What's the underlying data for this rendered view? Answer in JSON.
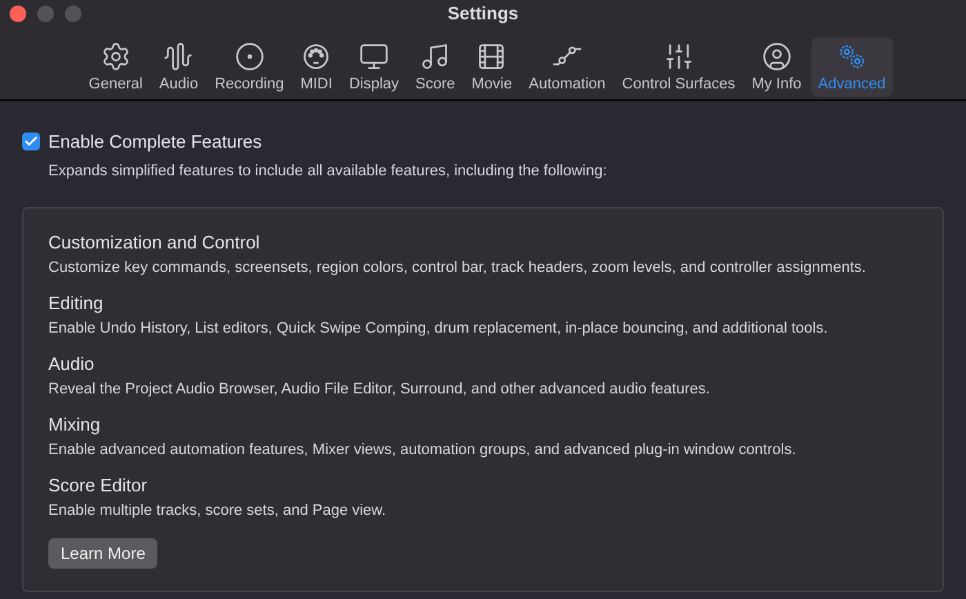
{
  "window": {
    "title": "Settings"
  },
  "tabs": [
    {
      "label": "General",
      "selected": false
    },
    {
      "label": "Audio",
      "selected": false
    },
    {
      "label": "Recording",
      "selected": false
    },
    {
      "label": "MIDI",
      "selected": false
    },
    {
      "label": "Display",
      "selected": false
    },
    {
      "label": "Score",
      "selected": false
    },
    {
      "label": "Movie",
      "selected": false
    },
    {
      "label": "Automation",
      "selected": false
    },
    {
      "label": "Control Surfaces",
      "selected": false
    },
    {
      "label": "My Info",
      "selected": false
    },
    {
      "label": "Advanced",
      "selected": true
    }
  ],
  "enable": {
    "label": "Enable Complete Features",
    "checked": true,
    "description": "Expands simplified features to include all available features, including the following:"
  },
  "sections": [
    {
      "title": "Customization and Control",
      "description": "Customize key commands, screensets, region colors, control bar, track headers, zoom levels, and controller assignments."
    },
    {
      "title": "Editing",
      "description": "Enable Undo History, List editors, Quick Swipe Comping, drum replacement, in-place bouncing, and additional tools."
    },
    {
      "title": "Audio",
      "description": "Reveal the Project Audio Browser, Audio File Editor, Surround, and other advanced audio features."
    },
    {
      "title": "Mixing",
      "description": "Enable advanced automation features, Mixer views, automation groups, and advanced plug-in window controls."
    },
    {
      "title": "Score Editor",
      "description": "Enable multiple tracks, score sets, and Page view."
    }
  ],
  "learn_more": "Learn More"
}
